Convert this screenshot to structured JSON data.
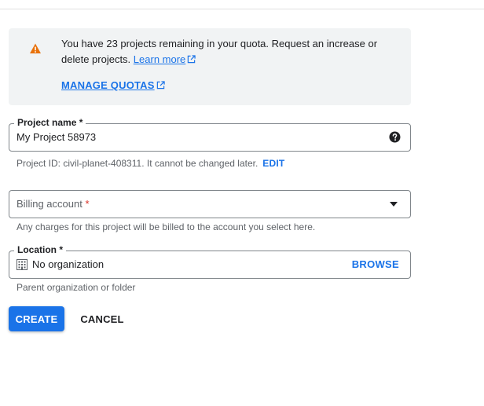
{
  "quota_banner": {
    "message": "You have 23 projects remaining in your quota. Request an increase or delete projects.",
    "learn_more_label": "Learn more",
    "manage_quotas_label": "MANAGE QUOTAS",
    "icon": "warning-icon",
    "icon_color": "#e8710a"
  },
  "project_name": {
    "label": "Project name *",
    "value": "My Project 58973",
    "help_icon": "help-icon"
  },
  "project_id": {
    "text": "Project ID: civil-planet-408311. It cannot be changed later.",
    "edit_label": "EDIT"
  },
  "billing": {
    "placeholder": "Billing account",
    "required_mark": "*",
    "hint": "Any charges for this project will be billed to the account you select here."
  },
  "location": {
    "label": "Location *",
    "value": "No organization",
    "browse_label": "BROWSE",
    "hint": "Parent organization or folder",
    "icon": "building-icon"
  },
  "actions": {
    "create_label": "CREATE",
    "cancel_label": "CANCEL"
  },
  "colors": {
    "accent": "#1a73e8",
    "required": "#d93025",
    "banner_bg": "#f1f3f4"
  }
}
